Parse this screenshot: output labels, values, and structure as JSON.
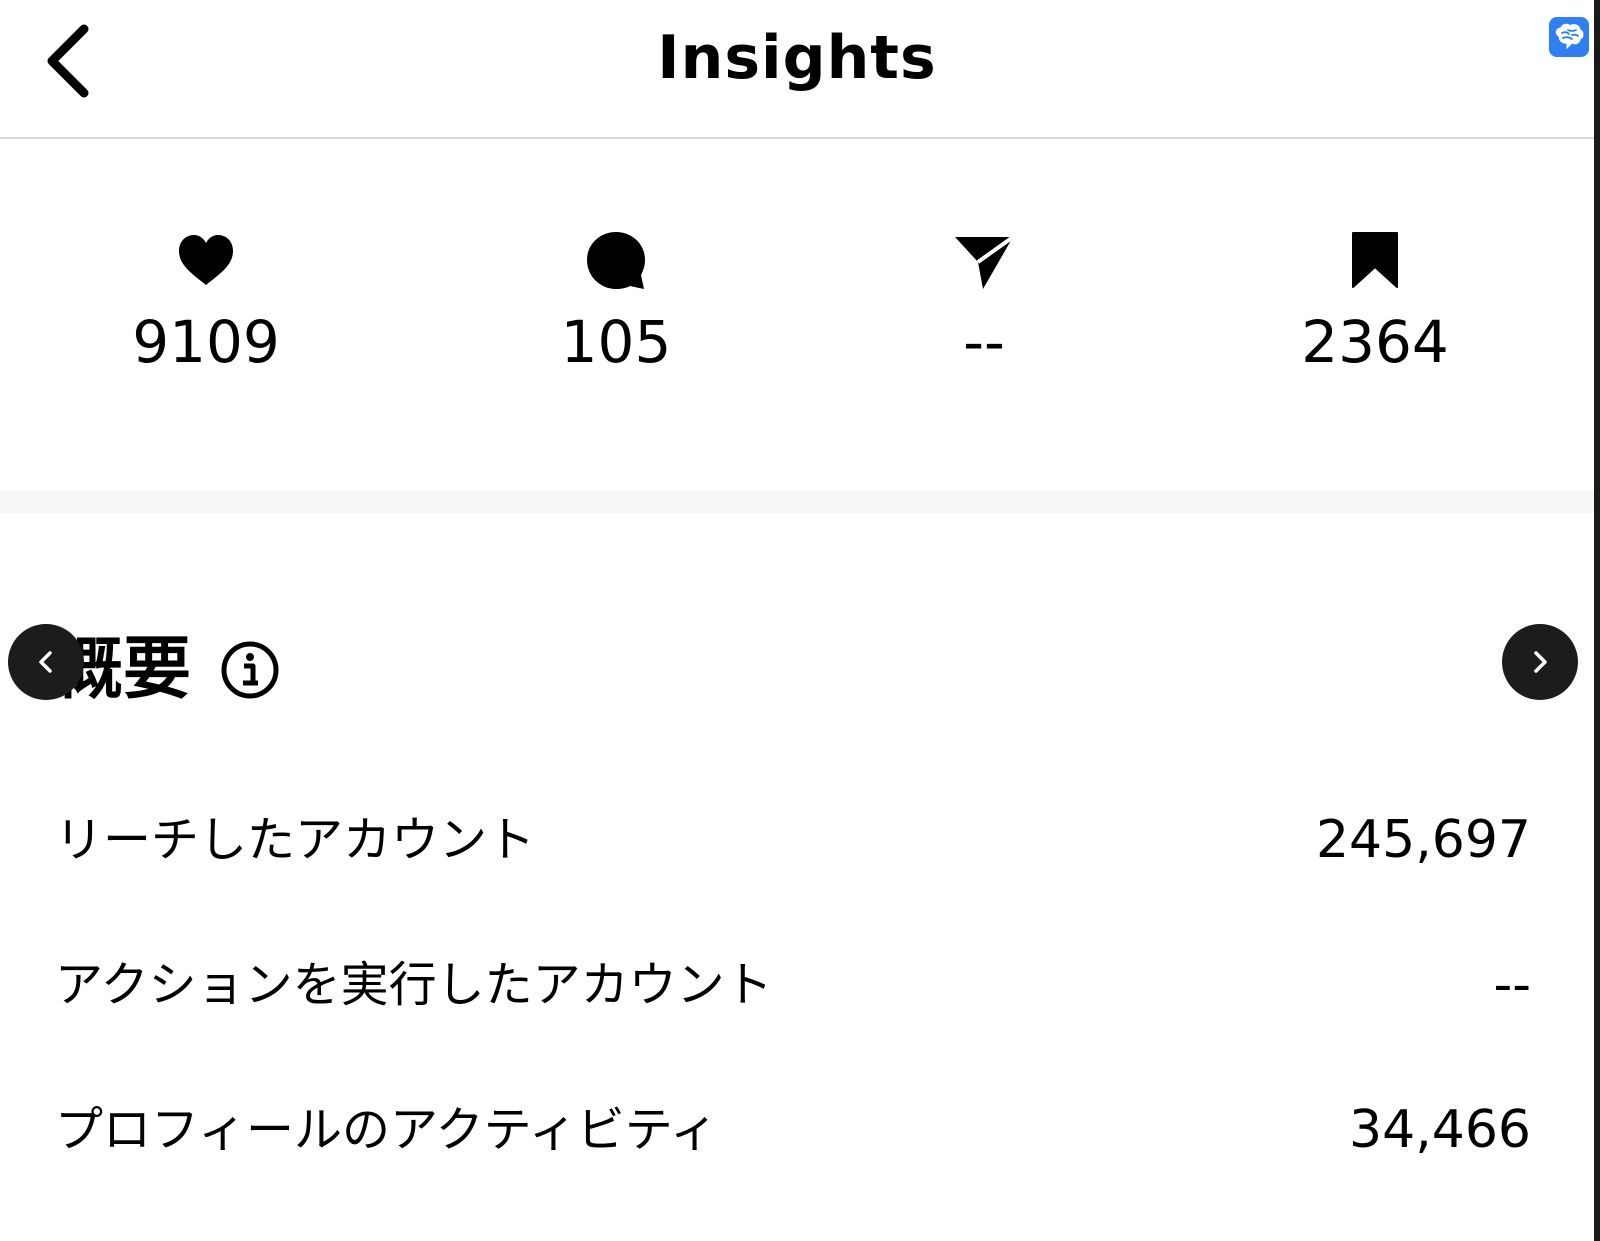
{
  "header": {
    "title": "Insights",
    "back_icon": "chevron-left-icon",
    "extension_icon": "brain-icon",
    "extension_color": "#2f7ff0"
  },
  "stats": [
    {
      "icon": "heart-icon",
      "value": "9109"
    },
    {
      "icon": "comment-icon",
      "value": "105"
    },
    {
      "icon": "send-icon",
      "value": "--"
    },
    {
      "icon": "bookmark-icon",
      "value": "2364"
    }
  ],
  "overview": {
    "title": "概要",
    "info_icon": "info-icon",
    "prev_icon": "chevron-left-icon",
    "next_icon": "chevron-right-icon",
    "metrics": [
      {
        "label": "リーチしたアカウント",
        "value": "245,697"
      },
      {
        "label": "アクションを実行したアカウント",
        "value": "--"
      },
      {
        "label": "プロフィールのアクティビティ",
        "value": "34,466"
      }
    ]
  }
}
